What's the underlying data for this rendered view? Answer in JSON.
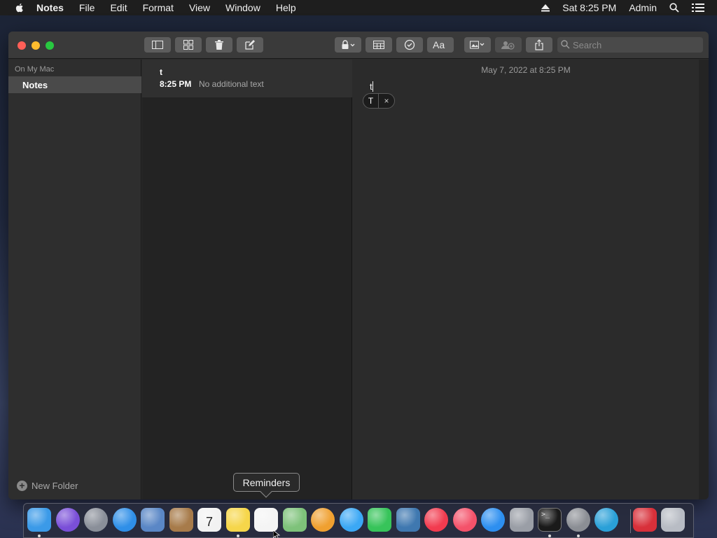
{
  "menubar": {
    "app_name": "Notes",
    "menus": [
      "File",
      "Edit",
      "Format",
      "View",
      "Window",
      "Help"
    ],
    "clock": "Sat 8:25 PM",
    "user": "Admin"
  },
  "toolbar": {
    "search_placeholder": "Search"
  },
  "sidebar": {
    "section_title": "On My Mac",
    "folders": [
      {
        "label": "Notes",
        "selected": true
      }
    ],
    "new_folder_label": "New Folder"
  },
  "note_list": {
    "notes": [
      {
        "title": "t",
        "time": "8:25 PM",
        "preview": "No additional text",
        "selected": true
      }
    ]
  },
  "editor": {
    "date": "May 7, 2022 at 8:25 PM",
    "body": "t",
    "suggestion": "T",
    "suggestion_close": "×"
  },
  "tooltip": {
    "text": "Reminders"
  },
  "dock": {
    "apps": [
      {
        "name": "Finder",
        "icon": "finder-icon",
        "color": "#3b9ae8",
        "running": true
      },
      {
        "name": "Siri",
        "icon": "siri-icon",
        "color": "#7a4fd8",
        "running": false
      },
      {
        "name": "Launchpad",
        "icon": "launchpad-icon",
        "color": "#8a8f99",
        "running": false
      },
      {
        "name": "Safari",
        "icon": "safari-icon",
        "color": "#2f8fe8",
        "running": false
      },
      {
        "name": "Mail",
        "icon": "mail-icon",
        "color": "#5a87c6",
        "running": false
      },
      {
        "name": "Contacts",
        "icon": "contacts-icon",
        "color": "#a77b4a",
        "running": false
      },
      {
        "name": "Calendar",
        "icon": "calendar-icon",
        "color": "#f2f2f2",
        "running": false
      },
      {
        "name": "Notes",
        "icon": "notes-icon",
        "color": "#f6d64a",
        "running": true
      },
      {
        "name": "Reminders",
        "icon": "reminders-icon",
        "color": "#f4f4f4",
        "running": false
      },
      {
        "name": "Maps",
        "icon": "maps-icon",
        "color": "#7ec27a",
        "running": false
      },
      {
        "name": "Photos",
        "icon": "photos-icon",
        "color": "#f0a030",
        "running": false
      },
      {
        "name": "Messages",
        "icon": "messages-icon",
        "color": "#3ba8f5",
        "running": false
      },
      {
        "name": "FaceTime",
        "icon": "facetime-icon",
        "color": "#37c45a",
        "running": false
      },
      {
        "name": "Python",
        "icon": "python-icon",
        "color": "#3f78b0",
        "running": false
      },
      {
        "name": "News",
        "icon": "news-icon",
        "color": "#f23b4f",
        "running": false
      },
      {
        "name": "Music",
        "icon": "music-icon",
        "color": "#f4526a",
        "running": false
      },
      {
        "name": "App Store",
        "icon": "app-store-icon",
        "color": "#2d8ff0",
        "running": false
      },
      {
        "name": "Disk Utility",
        "icon": "disk-utility-icon",
        "color": "#9a9ea6",
        "running": false
      },
      {
        "name": "Terminal",
        "icon": "terminal-icon",
        "color": "#1a1a1a",
        "running": true
      },
      {
        "name": "System Preferences",
        "icon": "system-preferences-icon",
        "color": "#8b8e94",
        "running": true
      },
      {
        "name": "Edge",
        "icon": "edge-icon",
        "color": "#2aa0d8",
        "running": false
      },
      {
        "name": "Downloads",
        "icon": "downloads-icon",
        "color": "#d8303a",
        "running": false
      },
      {
        "name": "Trash",
        "icon": "trash-icon",
        "color": "#b8bcc4",
        "running": false
      }
    ]
  },
  "colors": {
    "window_bg": "#2b2b2b",
    "accent_red": "#ff5f57",
    "accent_yellow": "#febc2e",
    "accent_green": "#28c840"
  }
}
